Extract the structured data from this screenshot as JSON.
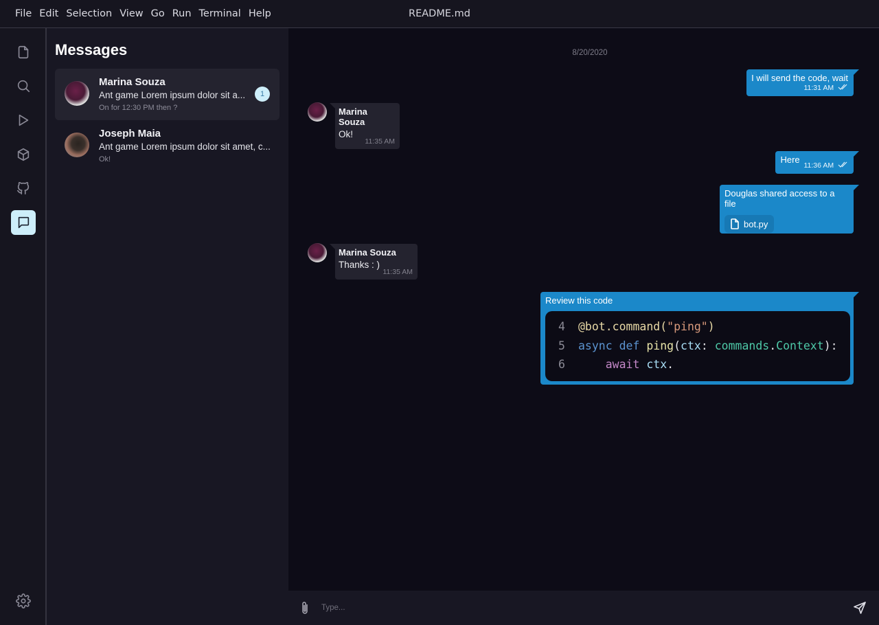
{
  "titlebar": {
    "menu": [
      "File",
      "Edit",
      "Selection",
      "View",
      "Go",
      "Run",
      "Terminal",
      "Help"
    ],
    "title": "README.md"
  },
  "activitybar": {
    "items": [
      {
        "icon": "file-icon",
        "active": false
      },
      {
        "icon": "search-icon",
        "active": false
      },
      {
        "icon": "run-icon",
        "active": false
      },
      {
        "icon": "extensions-cube-icon",
        "active": false
      },
      {
        "icon": "github-icon",
        "active": false
      },
      {
        "icon": "chat-icon",
        "active": true
      }
    ],
    "bottom_icon": "gear-icon"
  },
  "sidebar": {
    "title": "Messages",
    "conversations": [
      {
        "name": "Marina Souza",
        "preview": "Ant game Lorem ipsum dolor sit a...",
        "sub": "On for 12:30 PM then ?",
        "unread": "1",
        "selected": true
      },
      {
        "name": "Joseph Maia",
        "preview": "Ant game Lorem ipsum dolor sit amet, c...",
        "sub": "Ok!",
        "unread": null,
        "selected": false
      }
    ]
  },
  "chat": {
    "date": "8/20/2020",
    "messages": [
      {
        "dir": "out",
        "text": "I will send the code, wait",
        "time": "11:31 AM",
        "status": "read"
      },
      {
        "dir": "in",
        "sender": "Marina Souza",
        "text": "Ok!",
        "time": "11:35 AM"
      },
      {
        "dir": "out",
        "text": "Here",
        "time": "11:36 AM",
        "status": "read"
      },
      {
        "dir": "out",
        "text": "Douglas shared access to a file",
        "file": "bot.py"
      },
      {
        "dir": "in",
        "sender": "Marina Souza",
        "text": "Thanks : )",
        "time": "11:35 AM"
      },
      {
        "dir": "out",
        "text": "Review this code",
        "code": [
          {
            "line": "4",
            "text": "@bot.command(\"ping\")"
          },
          {
            "line": "5",
            "text": "async def ping(ctx: commands.Context):"
          },
          {
            "line": "6",
            "text": "    await ctx."
          }
        ]
      }
    ]
  },
  "composer": {
    "placeholder": "Type...",
    "value": ""
  },
  "colors": {
    "accent": "#1b88c9",
    "active_icon_bg": "#cdeefa",
    "background": "#0d0c17",
    "sidebar": "#181723"
  }
}
